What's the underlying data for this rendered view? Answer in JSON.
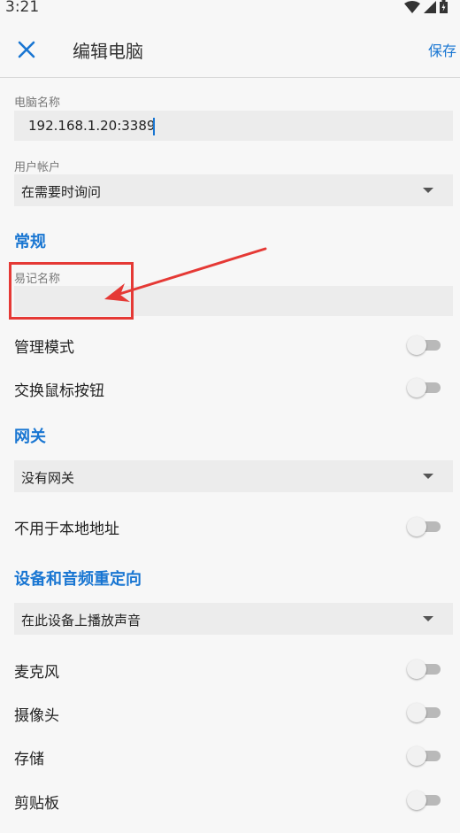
{
  "status_bar": {
    "time": "3:21"
  },
  "app_bar": {
    "title": "编辑电脑",
    "save_label": "保存"
  },
  "computer_name": {
    "label": "电脑名称",
    "value": "192.168.1.20:3389"
  },
  "user_account": {
    "label": "用户帐户",
    "selected": "在需要时询问"
  },
  "general": {
    "title": "常规",
    "friendly_name_label": "易记名称",
    "friendly_name_value": "",
    "admin_mode_label": "管理模式",
    "admin_mode_on": false,
    "swap_mouse_label": "交换鼠标按钮",
    "swap_mouse_on": false
  },
  "gateway": {
    "title": "网关",
    "selected": "没有网关",
    "bypass_local_label": "不用于本地地址",
    "bypass_local_on": false
  },
  "redirection": {
    "title": "设备和音频重定向",
    "audio_selected": "在此设备上播放声音",
    "microphone_label": "麦克风",
    "microphone_on": false,
    "camera_label": "摄像头",
    "camera_on": false,
    "storage_label": "存储",
    "storage_on": false,
    "clipboard_label": "剪贴板",
    "clipboard_on": false
  },
  "colors": {
    "accent": "#1976d2",
    "annotation": "#e53935"
  }
}
